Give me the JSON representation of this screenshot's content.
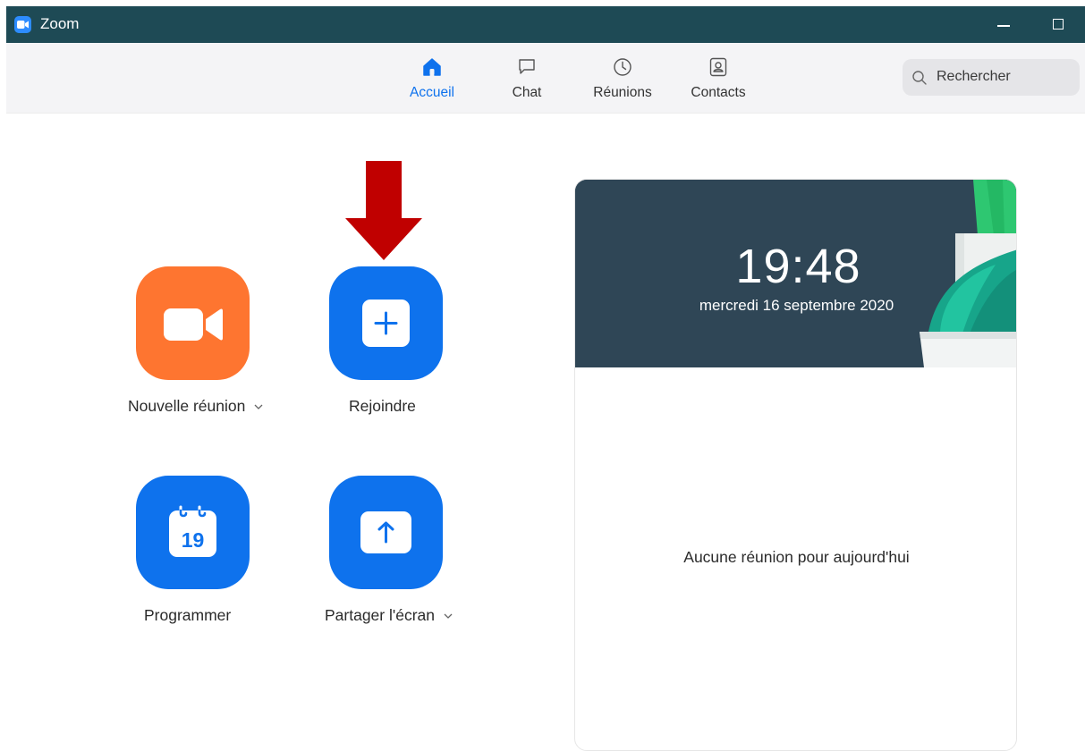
{
  "titlebar": {
    "title": "Zoom"
  },
  "nav": {
    "tabs": [
      {
        "label": "Accueil",
        "icon": "home-icon",
        "active": true
      },
      {
        "label": "Chat",
        "icon": "chat-bubble-icon",
        "active": false
      },
      {
        "label": "Réunions",
        "icon": "clock-icon",
        "active": false
      },
      {
        "label": "Contacts",
        "icon": "contact-card-icon",
        "active": false
      }
    ]
  },
  "search": {
    "placeholder": "Rechercher"
  },
  "actions": [
    {
      "label": "Nouvelle réunion",
      "icon": "video-camera-icon",
      "color": "#fe7530",
      "dropdown": true
    },
    {
      "label": "Rejoindre",
      "icon": "plus-icon",
      "color": "#0e72ed",
      "dropdown": false
    },
    {
      "label": "Programmer",
      "icon": "calendar-icon",
      "color": "#0e72ed",
      "dropdown": false,
      "calendar_day": "19"
    },
    {
      "label": "Partager l'écran",
      "icon": "share-arrow-up-icon",
      "color": "#0e72ed",
      "dropdown": true
    }
  ],
  "clock": {
    "time": "19:48",
    "date": "mercredi 16 septembre 2020"
  },
  "meetings": {
    "empty_message": "Aucune réunion pour aujourd'hui"
  },
  "colors": {
    "titlebar": "#1e4a55",
    "accent": "#0e72ed",
    "orange": "#fe7530",
    "annotation_arrow": "#c00000"
  }
}
